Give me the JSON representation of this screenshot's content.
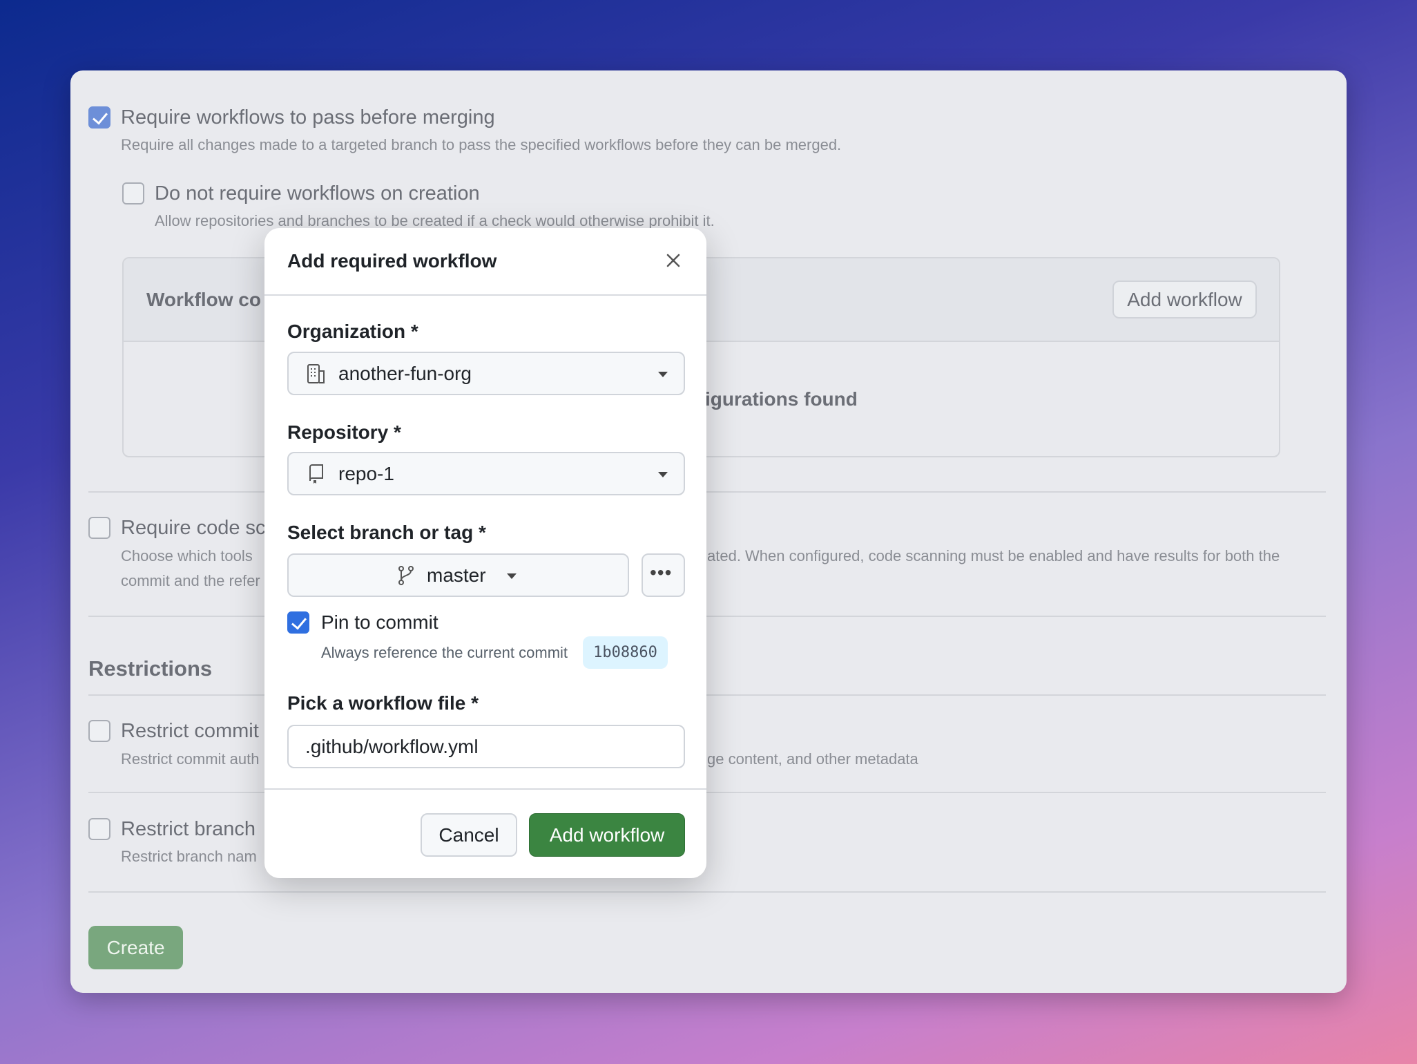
{
  "page": {
    "require_workflows": {
      "label": "Require workflows to pass before merging",
      "desc": "Require all changes made to a targeted branch to pass the specified workflows before they can be merged.",
      "checked": true
    },
    "no_require_creation": {
      "label": "Do not require workflows on creation",
      "desc": "Allow repositories and branches to be created if a check would otherwise prohibit it.",
      "checked": false
    },
    "workflow_box": {
      "title_fragment": "Workflow co",
      "add_button": "Add workflow",
      "empty_fragment": "igurations found"
    },
    "code_scanning": {
      "label_fragment": "Require code sc",
      "desc_left_1": "Choose which tools",
      "desc_right_1": "ated. When configured, code scanning must be enabled and have results for both the",
      "desc_left_2": "commit and the refer",
      "checked": false
    },
    "restrictions_heading": "Restrictions",
    "restrict_commit": {
      "label_fragment": "Restrict commit",
      "desc_left": "Restrict commit auth",
      "desc_right": "ge content, and other metadata",
      "checked": false
    },
    "restrict_branch": {
      "label_fragment": "Restrict branch",
      "desc_left": "Restrict branch nam",
      "checked": false
    },
    "create_button": "Create"
  },
  "modal": {
    "title": "Add required workflow",
    "close_icon": "x-icon",
    "organization": {
      "label": "Organization *",
      "value": "another-fun-org",
      "icon": "organization-icon"
    },
    "repository": {
      "label": "Repository *",
      "value": "repo-1",
      "icon": "repo-icon"
    },
    "branch": {
      "label": "Select branch or tag *",
      "value": "master",
      "icon": "git-branch-icon",
      "more_icon": "kebab-horizontal-icon"
    },
    "pin": {
      "label": "Pin to commit",
      "desc": "Always reference the current commit",
      "commit": "1b08860",
      "checked": true
    },
    "workflow_file": {
      "label": "Pick a workflow file *",
      "value": ".github/workflow.yml"
    },
    "cancel": "Cancel",
    "submit": "Add workflow"
  },
  "colors": {
    "accent": "#2f6fe0",
    "primary_button": "#3b8541",
    "create_button": "#79a77e",
    "commit_badge_bg": "#ddf4ff"
  }
}
